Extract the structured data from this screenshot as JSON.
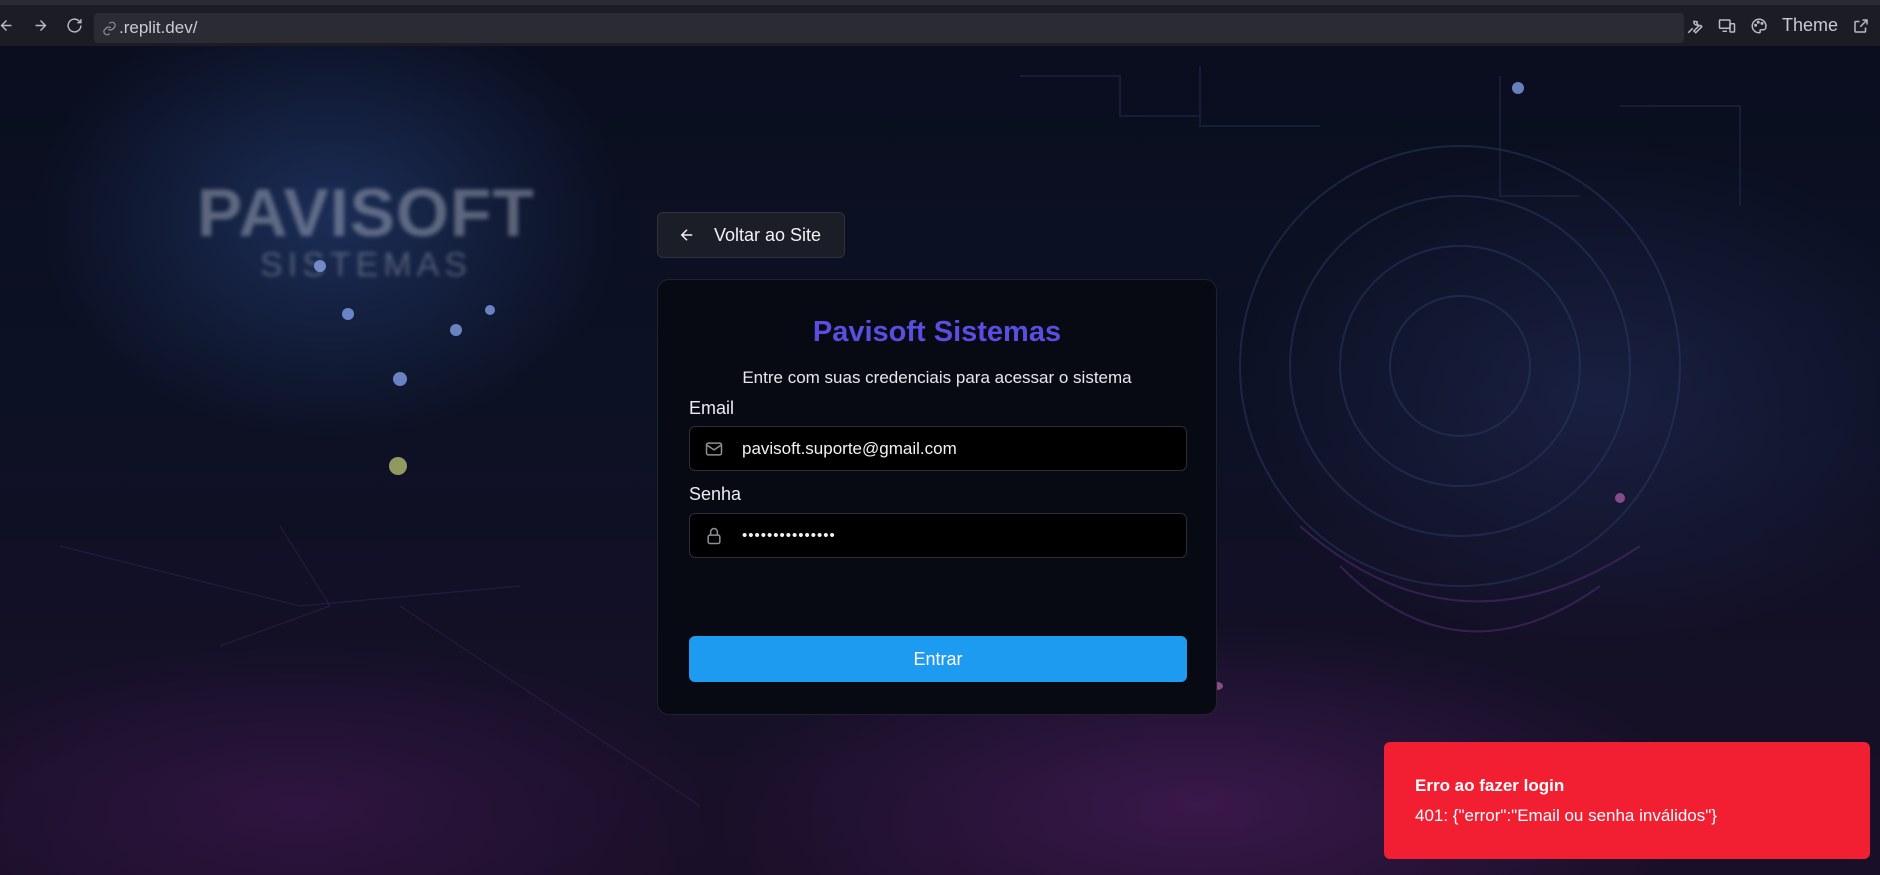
{
  "browser": {
    "url": ".replit.dev/",
    "theme_label": "Theme"
  },
  "background": {
    "brand_name": "PAVISOFT",
    "brand_sub": "SISTEMAS"
  },
  "back_button": {
    "label": "Voltar ao Site"
  },
  "card": {
    "title": "Pavisoft Sistemas",
    "subtitle": "Entre com suas credenciais para acessar o sistema",
    "email": {
      "label": "Email",
      "value": "pavisoft.suporte@gmail.com"
    },
    "password": {
      "label": "Senha",
      "value": "•••••••••••••••"
    },
    "submit_label": "Entrar"
  },
  "toast": {
    "title": "Erro ao fazer login",
    "message": "401: {\"error\":\"Email ou senha inválidos\"}"
  },
  "colors": {
    "accent_title": "#5b4de0",
    "primary_button": "#1d9bf0",
    "toast_error": "#f21f32"
  },
  "icons": {
    "back": "arrow-left-icon",
    "forward": "arrow-right-icon",
    "reload": "reload-icon",
    "link": "link-icon",
    "wrench": "wrench-icon",
    "devices": "devices-icon",
    "palette": "palette-icon",
    "external": "external-link-icon",
    "mail": "mail-icon",
    "lock": "lock-icon"
  }
}
